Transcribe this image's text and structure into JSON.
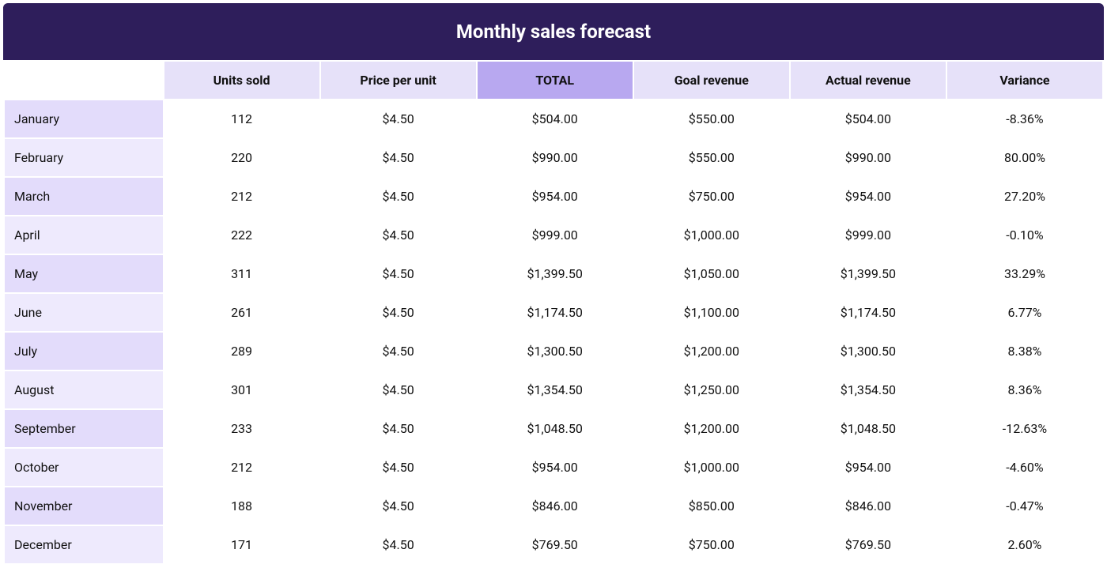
{
  "title": "Monthly sales forecast",
  "headers": {
    "label": "",
    "units_sold": "Units sold",
    "price_per_unit": "Price per unit",
    "total": "TOTAL",
    "goal_revenue": "Goal revenue",
    "actual_revenue": "Actual revenue",
    "variance": "Variance"
  },
  "rows": [
    {
      "month": "January",
      "units_sold": "112",
      "price_per_unit": "$4.50",
      "total": "$504.00",
      "goal_revenue": "$550.00",
      "actual_revenue": "$504.00",
      "variance": "-8.36%"
    },
    {
      "month": "February",
      "units_sold": "220",
      "price_per_unit": "$4.50",
      "total": "$990.00",
      "goal_revenue": "$550.00",
      "actual_revenue": "$990.00",
      "variance": "80.00%"
    },
    {
      "month": "March",
      "units_sold": "212",
      "price_per_unit": "$4.50",
      "total": "$954.00",
      "goal_revenue": "$750.00",
      "actual_revenue": "$954.00",
      "variance": "27.20%"
    },
    {
      "month": "April",
      "units_sold": "222",
      "price_per_unit": "$4.50",
      "total": "$999.00",
      "goal_revenue": "$1,000.00",
      "actual_revenue": "$999.00",
      "variance": "-0.10%"
    },
    {
      "month": "May",
      "units_sold": "311",
      "price_per_unit": "$4.50",
      "total": "$1,399.50",
      "goal_revenue": "$1,050.00",
      "actual_revenue": "$1,399.50",
      "variance": "33.29%"
    },
    {
      "month": "June",
      "units_sold": "261",
      "price_per_unit": "$4.50",
      "total": "$1,174.50",
      "goal_revenue": "$1,100.00",
      "actual_revenue": "$1,174.50",
      "variance": "6.77%"
    },
    {
      "month": "July",
      "units_sold": "289",
      "price_per_unit": "$4.50",
      "total": "$1,300.50",
      "goal_revenue": "$1,200.00",
      "actual_revenue": "$1,300.50",
      "variance": "8.38%"
    },
    {
      "month": "August",
      "units_sold": "301",
      "price_per_unit": "$4.50",
      "total": "$1,354.50",
      "goal_revenue": "$1,250.00",
      "actual_revenue": "$1,354.50",
      "variance": "8.36%"
    },
    {
      "month": "September",
      "units_sold": "233",
      "price_per_unit": "$4.50",
      "total": "$1,048.50",
      "goal_revenue": "$1,200.00",
      "actual_revenue": "$1,048.50",
      "variance": "-12.63%"
    },
    {
      "month": "October",
      "units_sold": "212",
      "price_per_unit": "$4.50",
      "total": "$954.00",
      "goal_revenue": "$1,000.00",
      "actual_revenue": "$954.00",
      "variance": "-4.60%"
    },
    {
      "month": "November",
      "units_sold": "188",
      "price_per_unit": "$4.50",
      "total": "$846.00",
      "goal_revenue": "$850.00",
      "actual_revenue": "$846.00",
      "variance": "-0.47%"
    },
    {
      "month": "December",
      "units_sold": "171",
      "price_per_unit": "$4.50",
      "total": "$769.50",
      "goal_revenue": "$750.00",
      "actual_revenue": "$769.50",
      "variance": "2.60%"
    }
  ],
  "chart_data": {
    "type": "table",
    "title": "Monthly sales forecast",
    "columns": [
      "Month",
      "Units sold",
      "Price per unit",
      "TOTAL",
      "Goal revenue",
      "Actual revenue",
      "Variance"
    ],
    "data": [
      [
        "January",
        112,
        4.5,
        504.0,
        550.0,
        504.0,
        -8.36
      ],
      [
        "February",
        220,
        4.5,
        990.0,
        550.0,
        990.0,
        80.0
      ],
      [
        "March",
        212,
        4.5,
        954.0,
        750.0,
        954.0,
        27.2
      ],
      [
        "April",
        222,
        4.5,
        999.0,
        1000.0,
        999.0,
        -0.1
      ],
      [
        "May",
        311,
        4.5,
        1399.5,
        1050.0,
        1399.5,
        33.29
      ],
      [
        "June",
        261,
        4.5,
        1174.5,
        1100.0,
        1174.5,
        6.77
      ],
      [
        "July",
        289,
        4.5,
        1300.5,
        1200.0,
        1300.5,
        8.38
      ],
      [
        "August",
        301,
        4.5,
        1354.5,
        1250.0,
        1354.5,
        8.36
      ],
      [
        "September",
        233,
        4.5,
        1048.5,
        1200.0,
        1048.5,
        -12.63
      ],
      [
        "October",
        212,
        4.5,
        954.0,
        1000.0,
        954.0,
        -4.6
      ],
      [
        "November",
        188,
        4.5,
        846.0,
        850.0,
        846.0,
        -0.47
      ],
      [
        "December",
        171,
        4.5,
        769.5,
        750.0,
        769.5,
        2.6
      ]
    ]
  }
}
